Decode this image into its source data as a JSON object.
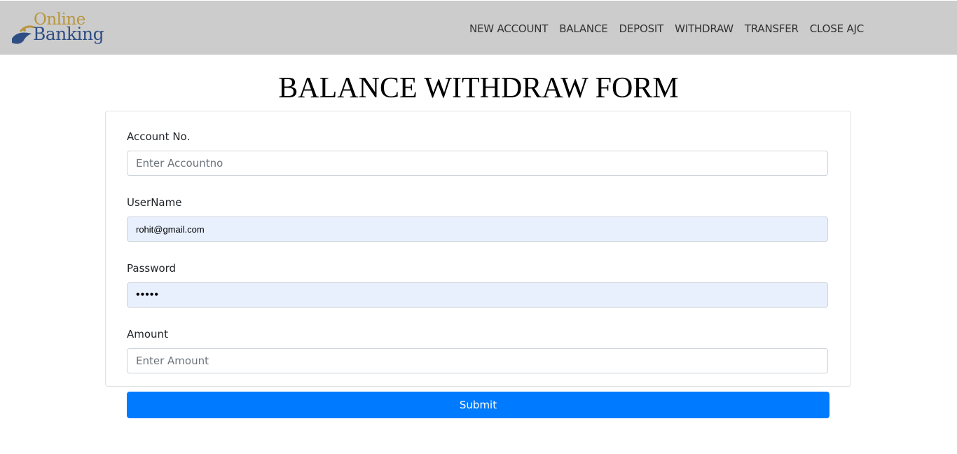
{
  "navbar": {
    "logo": {
      "line1": "Online",
      "line2": "Banking"
    },
    "links": [
      {
        "label": "NEW ACCOUNT"
      },
      {
        "label": "BALANCE"
      },
      {
        "label": "DEPOSIT"
      },
      {
        "label": "WITHDRAW"
      },
      {
        "label": "TRANSFER"
      },
      {
        "label": "CLOSE AJC"
      }
    ]
  },
  "form": {
    "title": "BALANCE WITHDRAW FORM",
    "account": {
      "label": "Account No.",
      "placeholder": "Enter Accountno",
      "value": ""
    },
    "username": {
      "label": "UserName",
      "value": "rohit@gmail.com"
    },
    "password": {
      "label": "Password",
      "value": "•••••"
    },
    "amount": {
      "label": "Amount",
      "placeholder": "Enter Amount",
      "value": ""
    },
    "submit_label": "Submit"
  },
  "colors": {
    "navbar_bg": "#cccccc",
    "primary": "#007bff",
    "autofill_bg": "#e8f0fe",
    "logo_gold": "#b8963e",
    "logo_blue": "#2f4f84"
  },
  "icons": {
    "logo": "banking-logo-icon"
  }
}
